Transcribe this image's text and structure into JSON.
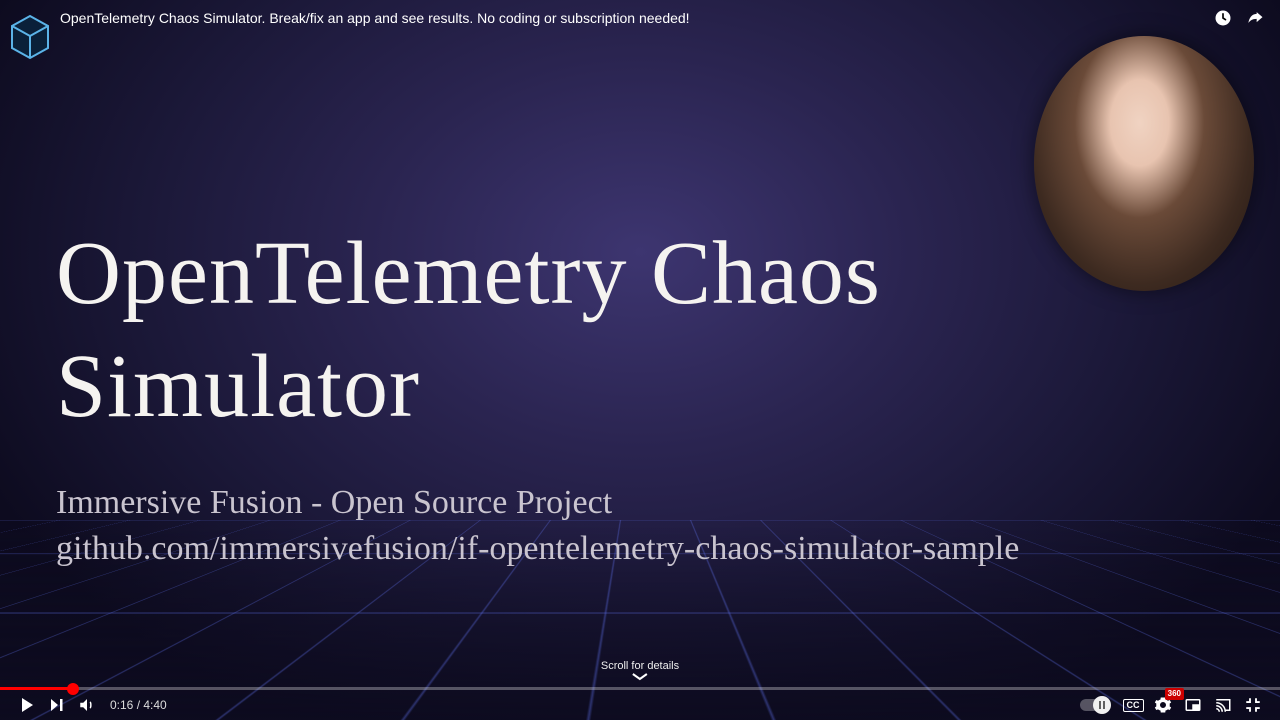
{
  "top": {
    "title": "OpenTelemetry Chaos Simulator. Break/fix an app and see results. No coding or subscription needed!",
    "watch_later": "Watch later",
    "share": "Share"
  },
  "content": {
    "headline": "OpenTelemetry Chaos Simulator",
    "sub1": "Immersive Fusion - Open Source Project",
    "sub2": "github.com/immersivefusion/if-opentelemetry-chaos-simulator-sample"
  },
  "player": {
    "elapsed": "0:16",
    "duration": "4:40",
    "progress_percent": 5.7,
    "scroll_label": "Scroll for details",
    "cc_label": "CC",
    "yt_label": "360"
  },
  "colors": {
    "progress": "#ff0000",
    "bg_center": "#3d3570",
    "bg_edge": "#0d0b1f",
    "grid": "rgba(100,120,255,0.35)"
  }
}
